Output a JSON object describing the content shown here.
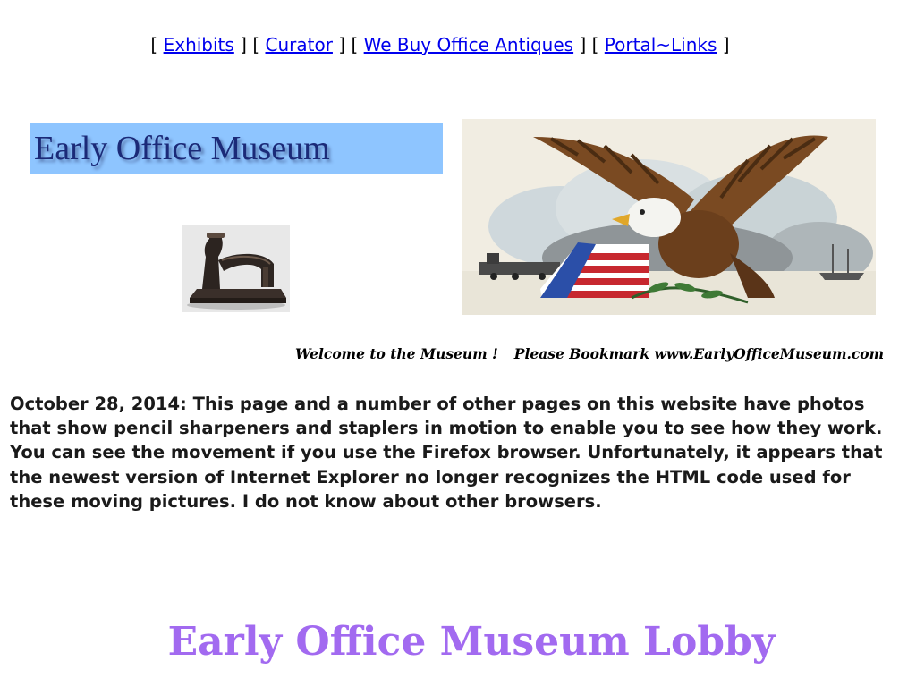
{
  "nav": {
    "items": [
      {
        "label": "Exhibits"
      },
      {
        "label": "Curator"
      },
      {
        "label": "We Buy Office Antiques"
      },
      {
        "label": "Portal~Links"
      }
    ],
    "open_bracket": "[",
    "close_bracket": "]"
  },
  "banner": {
    "title": "Early Office Museum",
    "background": "#8ec5ff",
    "text_color": "#1b2a78"
  },
  "images": {
    "stapler": "stapler-photo",
    "eagle": "eagle-with-flag-illustration"
  },
  "welcome": {
    "left": "Welcome to the Museum !",
    "right": "Please Bookmark  www.EarlyOfficeMuseum.com"
  },
  "notice": {
    "text": "October 28, 2014: This page and a number of other pages on this website have photos that show pencil sharpeners and staplers in motion to enable you to see how they work. You can see the movement if you use the Firefox browser. Unfortunately, it appears that the newest version of Internet Explorer no longer recognizes the HTML code used for these moving pictures. I do not know about other browsers."
  },
  "lobby": {
    "title": "Early Office Museum Lobby",
    "color": "#a26af0"
  },
  "colors": {
    "link": "#0000ee"
  }
}
